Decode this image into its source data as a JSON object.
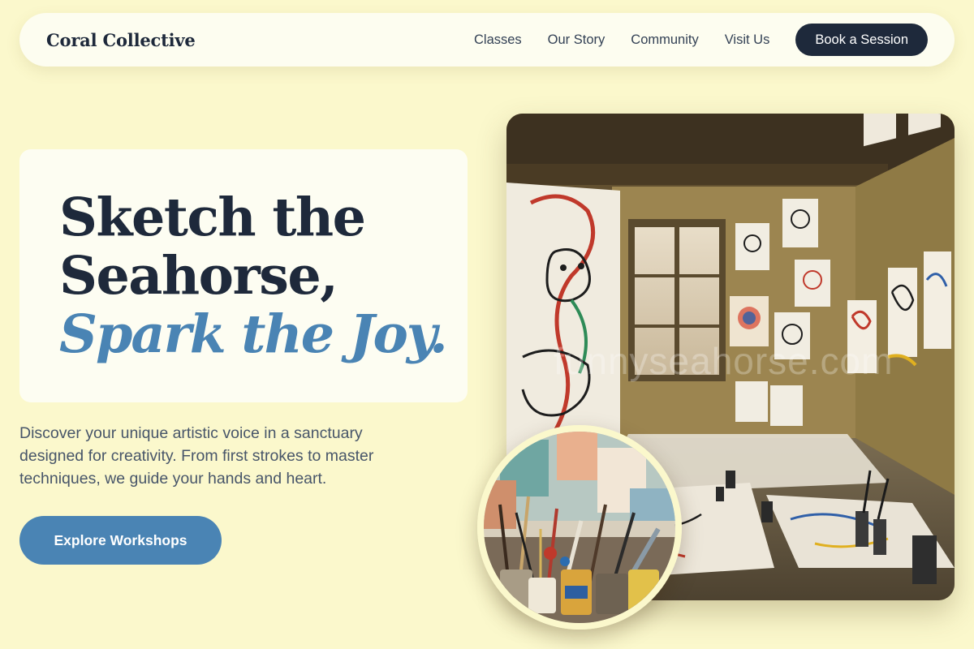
{
  "nav": {
    "brand": "Coral Collective",
    "links": [
      "Classes",
      "Our Story",
      "Community",
      "Visit Us"
    ],
    "cta": "Book a Session"
  },
  "hero": {
    "title_line1": "Sketch the",
    "title_line2": "Seahorse,",
    "title_accent": "Spark the Joy.",
    "description": "Discover your unique artistic voice in a sanctuary designed for creativity. From first strokes to master techniques, we guide your hands and heart.",
    "button": "Explore Workshops"
  },
  "images": {
    "main_watermark": "funnyseahorse.com"
  },
  "colors": {
    "background": "#fbf8cc",
    "navy": "#1e293b",
    "accent_blue": "#4a84b4",
    "card": "#fdfdf2"
  }
}
